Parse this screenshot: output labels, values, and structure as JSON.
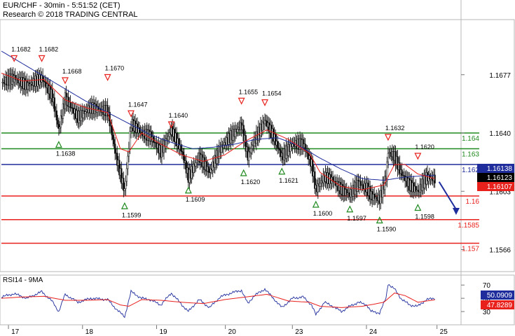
{
  "header": {
    "title": "EUR/CHF - 30min - 5:51:52 (CET)",
    "copyright": "Research © 2018 TRADING CENTRAL"
  },
  "chart_data": [
    {
      "type": "line",
      "subtype": "candlestick-price",
      "y_axis_ticks": [
        1.1677,
        1.164,
        1.1603,
        1.1566
      ],
      "ylim": [
        1.1552,
        1.1712
      ],
      "x_tick_labels": [
        "17",
        "18",
        "19",
        "20",
        "23",
        "24",
        "25"
      ],
      "price_labels": [
        {
          "value": 1.16138,
          "label": "1.16138",
          "color": "#1f2d9c"
        },
        {
          "value": 1.16123,
          "label": "1.16123",
          "color": "#000000"
        },
        {
          "value": 1.16107,
          "label": "1.16107",
          "color": "#e8211d"
        }
      ],
      "horizontal_levels": [
        {
          "value": 1.164,
          "label": "1.164",
          "color": "#1f8a1f",
          "label_color": "#1f8a1f"
        },
        {
          "value": 1.163,
          "label": "1.163",
          "color": "#1f8a1f",
          "label_color": "#1f8a1f"
        },
        {
          "value": 1.162,
          "label": "1.162",
          "color": "#1f2d9c",
          "label_color": "#1f2d9c"
        },
        {
          "value": 1.16,
          "label": "1.16",
          "color": "#e8211d",
          "label_color": "#e8211d"
        },
        {
          "value": 1.1585,
          "label": "1.1585",
          "color": "#e8211d",
          "label_color": "#e8211d"
        },
        {
          "value": 1.157,
          "label": "1.157",
          "color": "#e8211d",
          "label_color": "#e8211d"
        }
      ],
      "peaks": [
        {
          "t": 6,
          "value": 1.1682,
          "label": "1.1682"
        },
        {
          "t": 19,
          "value": 1.1682,
          "label": "1.1682"
        },
        {
          "t": 30,
          "value": 1.1668,
          "label": "1.1668"
        },
        {
          "t": 50,
          "value": 1.167,
          "label": "1.1670"
        },
        {
          "t": 61,
          "value": 1.1647,
          "label": "1.1647"
        },
        {
          "t": 80,
          "value": 1.164,
          "label": "1.1640"
        },
        {
          "t": 113,
          "value": 1.1655,
          "label": "1.1655"
        },
        {
          "t": 124,
          "value": 1.1654,
          "label": "1.1654"
        },
        {
          "t": 182,
          "value": 1.1632,
          "label": "1.1632"
        },
        {
          "t": 196,
          "value": 1.162,
          "label": "1.1620"
        }
      ],
      "troughs": [
        {
          "t": 27,
          "value": 1.1638,
          "label": "1.1638"
        },
        {
          "t": 58,
          "value": 1.1599,
          "label": "1.1599"
        },
        {
          "t": 88,
          "value": 1.1609,
          "label": "1.1609"
        },
        {
          "t": 114,
          "value": 1.162,
          "label": "1.1620"
        },
        {
          "t": 132,
          "value": 1.1621,
          "label": "1.1621"
        },
        {
          "t": 148,
          "value": 1.16,
          "label": "1.1600"
        },
        {
          "t": 164,
          "value": 1.1597,
          "label": "1.1597"
        },
        {
          "t": 178,
          "value": 1.159,
          "label": "1.1590"
        },
        {
          "t": 196,
          "value": 1.1598,
          "label": "1.1598"
        }
      ],
      "series": [
        {
          "role": "price",
          "color": "#000000",
          "t": [
            0,
            6,
            12,
            19,
            24,
            27,
            30,
            36,
            42,
            50,
            54,
            58,
            61,
            66,
            70,
            75,
            80,
            85,
            88,
            93,
            98,
            103,
            108,
            113,
            116,
            119,
            124,
            128,
            132,
            137,
            142,
            146,
            148,
            152,
            156,
            160,
            164,
            168,
            172,
            174,
            178,
            181,
            182,
            185,
            188,
            192,
            196,
            200,
            204
          ],
          "values": [
            1.1672,
            1.1675,
            1.167,
            1.1675,
            1.1663,
            1.1642,
            1.1662,
            1.165,
            1.1656,
            1.1654,
            1.1625,
            1.1603,
            1.1646,
            1.164,
            1.1638,
            1.1628,
            1.1642,
            1.1628,
            1.1612,
            1.1625,
            1.1615,
            1.163,
            1.1638,
            1.1645,
            1.1625,
            1.1635,
            1.1648,
            1.1638,
            1.1625,
            1.1633,
            1.1633,
            1.162,
            1.1604,
            1.1612,
            1.161,
            1.1604,
            1.1601,
            1.1608,
            1.1605,
            1.16,
            1.1598,
            1.1612,
            1.1628,
            1.1625,
            1.1615,
            1.1607,
            1.1603,
            1.1612,
            1.1611
          ]
        },
        {
          "role": "moving-average-blue",
          "color": "#1f2d9c",
          "t": [
            0,
            10,
            20,
            30,
            40,
            50,
            60,
            70,
            80,
            90,
            100,
            110,
            120,
            130,
            140,
            150,
            160,
            170,
            180,
            190,
            200,
            204
          ],
          "values": [
            1.1692,
            1.1684,
            1.1676,
            1.1668,
            1.166,
            1.1653,
            1.1646,
            1.1639,
            1.1634,
            1.163,
            1.1631,
            1.1633,
            1.1636,
            1.1637,
            1.1632,
            1.1624,
            1.1617,
            1.1611,
            1.161,
            1.1612,
            1.1613,
            1.1613
          ]
        },
        {
          "role": "moving-average-red",
          "color": "#e8211d",
          "t": [
            0,
            10,
            20,
            30,
            40,
            50,
            56,
            60,
            66,
            75,
            85,
            95,
            105,
            115,
            125,
            135,
            145,
            150,
            160,
            170,
            180,
            185,
            190,
            196,
            204
          ],
          "values": [
            1.1678,
            1.1673,
            1.1674,
            1.1661,
            1.1656,
            1.1653,
            1.163,
            1.1628,
            1.164,
            1.1633,
            1.1626,
            1.1622,
            1.1626,
            1.1635,
            1.1642,
            1.1636,
            1.1627,
            1.1615,
            1.1606,
            1.1604,
            1.1607,
            1.162,
            1.162,
            1.1614,
            1.1611
          ]
        }
      ],
      "forecast_arrow": {
        "from_t": 206,
        "from_value": 1.1609,
        "to_t": 214,
        "to_value": 1.1588,
        "color": "#1f2d9c"
      }
    },
    {
      "type": "line",
      "subtype": "oscillator",
      "title": "RSI14 - 9MA",
      "ylim": [
        10,
        85
      ],
      "y_axis_ticks": [
        70,
        50,
        30
      ],
      "value_labels": [
        {
          "value": 50.0909,
          "label": "50.0909",
          "color": "#1f2d9c"
        },
        {
          "value": 47.8289,
          "label": "47.8289",
          "color": "#e8211d"
        }
      ],
      "series": [
        {
          "name": "RSI14",
          "color": "#1f2d9c",
          "t": [
            0,
            6,
            12,
            19,
            24,
            27,
            30,
            36,
            42,
            50,
            54,
            58,
            61,
            66,
            70,
            75,
            80,
            85,
            88,
            93,
            98,
            103,
            108,
            113,
            116,
            119,
            124,
            128,
            132,
            137,
            142,
            146,
            148,
            152,
            156,
            160,
            164,
            168,
            172,
            174,
            178,
            181,
            182,
            185,
            188,
            192,
            196,
            200,
            204
          ],
          "values": [
            52,
            57,
            50,
            60,
            45,
            30,
            56,
            44,
            50,
            48,
            34,
            22,
            60,
            50,
            48,
            40,
            58,
            40,
            30,
            48,
            36,
            52,
            58,
            62,
            42,
            54,
            64,
            50,
            36,
            50,
            52,
            40,
            25,
            44,
            38,
            30,
            38,
            44,
            40,
            30,
            28,
            50,
            72,
            64,
            50,
            40,
            38,
            48,
            50
          ]
        },
        {
          "name": "9MA",
          "color": "#e8211d",
          "t": [
            0,
            10,
            20,
            30,
            40,
            50,
            56,
            60,
            66,
            75,
            85,
            95,
            105,
            115,
            125,
            135,
            145,
            150,
            160,
            170,
            180,
            185,
            190,
            196,
            204
          ],
          "values": [
            50,
            52,
            53,
            47,
            47,
            48,
            40,
            38,
            48,
            47,
            44,
            42,
            48,
            52,
            56,
            46,
            44,
            38,
            36,
            38,
            44,
            58,
            54,
            44,
            47.8
          ]
        }
      ]
    }
  ]
}
